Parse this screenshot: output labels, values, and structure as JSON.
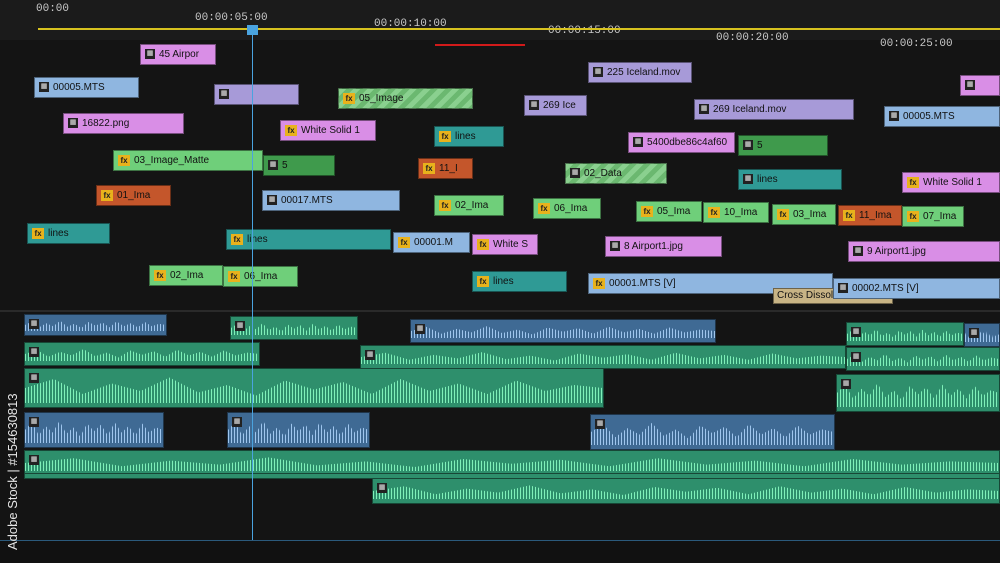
{
  "ruler": {
    "labels": [
      "00:00",
      "00:00:05:00",
      "00:00:10:00",
      "00:00:15:00",
      "00:00:20:00",
      "00:00:25:00"
    ]
  },
  "video_clips": [
    {
      "label": "45 Airpor"
    },
    {
      "label": "00005.MTS"
    },
    {
      "label": ""
    },
    {
      "label": "05_Image"
    },
    {
      "label": "225 Iceland.mov"
    },
    {
      "label": ""
    },
    {
      "label": "269 Ice"
    },
    {
      "label": "269 Iceland.mov"
    },
    {
      "label": "00005.MTS"
    },
    {
      "label": "16822.png"
    },
    {
      "label": "White Solid 1"
    },
    {
      "label": "lines"
    },
    {
      "label": "5400dbe86c4af60"
    },
    {
      "label": "5"
    },
    {
      "label": "03_Image_Matte"
    },
    {
      "label": "5"
    },
    {
      "label": "11_I"
    },
    {
      "label": "02_Data"
    },
    {
      "label": "lines"
    },
    {
      "label": "White Solid 1"
    },
    {
      "label": "01_Ima"
    },
    {
      "label": "00017.MTS"
    },
    {
      "label": "02_Ima"
    },
    {
      "label": "06_Ima"
    },
    {
      "label": "05_Ima"
    },
    {
      "label": "10_Ima"
    },
    {
      "label": "03_Ima"
    },
    {
      "label": "11_Ima"
    },
    {
      "label": "07_Ima"
    },
    {
      "label": "lines"
    },
    {
      "label": "lines"
    },
    {
      "label": "00001.M"
    },
    {
      "label": "White S"
    },
    {
      "label": "8 Airport1.jpg"
    },
    {
      "label": "9 Airport1.jpg"
    },
    {
      "label": "02_Ima"
    },
    {
      "label": "06_Ima"
    },
    {
      "label": "lines"
    },
    {
      "label": "00001.MTS [V]"
    },
    {
      "label": "Cross Dissolve"
    },
    {
      "label": "00002.MTS [V]"
    }
  ],
  "audio_clips": [
    {},
    {},
    {},
    {},
    {},
    {},
    {},
    {},
    {},
    {},
    {},
    {},
    {},
    {},
    {},
    {}
  ],
  "playhead": {
    "time": "00:00:05:00"
  },
  "watermark": "Adobe Stock | #154630813",
  "colors": {
    "pink": "#d98ee6",
    "lavender": "#a79ad8",
    "blue": "#8fb6e0",
    "green": "#6fcf7a",
    "dark_green": "#3f9a4c",
    "teal": "#2f9a95",
    "orange_red": "#c4562b",
    "aqua": "#3ec7a6",
    "playhead": "#4aa3df"
  }
}
